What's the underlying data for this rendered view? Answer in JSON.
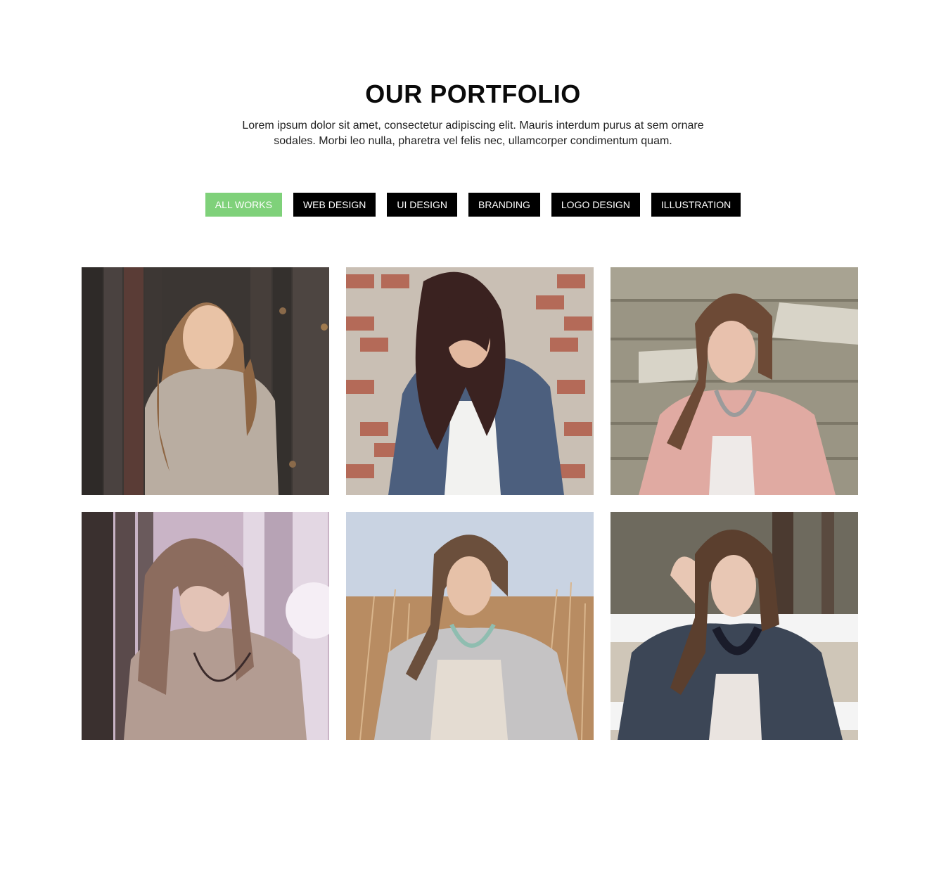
{
  "header": {
    "title": "OUR PORTFOLIO",
    "description": "Lorem ipsum dolor sit amet, consectetur adipiscing elit. Mauris interdum purus at sem ornare sodales. Morbi leo nulla, pharetra vel felis nec, ullamcorper condimentum quam."
  },
  "filters": [
    {
      "label": "ALL WORKS",
      "active": true
    },
    {
      "label": "WEB DESIGN",
      "active": false
    },
    {
      "label": "UI DESIGN",
      "active": false
    },
    {
      "label": "BRANDING",
      "active": false
    },
    {
      "label": "LOGO DESIGN",
      "active": false
    },
    {
      "label": "ILLUSTRATION",
      "active": false
    }
  ],
  "colors": {
    "accent": "#7fd17a",
    "button_bg": "#000000",
    "button_text": "#ffffff"
  },
  "portfolio_items": [
    {
      "scene": "woman-wood-fence"
    },
    {
      "scene": "woman-brick-wall"
    },
    {
      "scene": "woman-pink-blazer-stone"
    },
    {
      "scene": "woman-backlit-fence"
    },
    {
      "scene": "woman-wheat-field"
    },
    {
      "scene": "woman-white-fence-trees"
    }
  ]
}
